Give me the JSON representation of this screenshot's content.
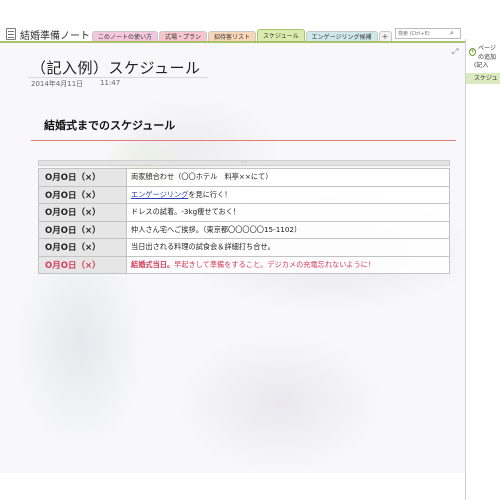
{
  "notebook": {
    "title": "結婚準備ノート",
    "tabs": [
      {
        "label": "このノートの使い方",
        "color": "#f3c8dc",
        "active": false
      },
      {
        "label": "式場・プラン",
        "color": "#f6c6cc",
        "active": false
      },
      {
        "label": "招待客リスト",
        "color": "#f8d7b9",
        "active": false
      },
      {
        "label": "スケジュール",
        "color": "#d9ecae",
        "active": true
      },
      {
        "label": "エンゲージリング候補",
        "color": "#cfe8ea",
        "active": false
      }
    ],
    "add_tab_label": "+",
    "search_placeholder": "検索 (Ctrl+E)"
  },
  "right_pane": {
    "add_page_label": "ページの追加",
    "pages": [
      "(記入",
      "スケジュ"
    ]
  },
  "page": {
    "title": "（記入例）スケジュール",
    "date": "2014年4月11日",
    "time": "11:47",
    "heading": "結婚式までのスケジュール"
  },
  "schedule": {
    "rows": [
      {
        "date": "O月O日（×）",
        "desc": "両家顔合わせ（〇〇ホテル　料亭××にて）"
      },
      {
        "date": "O月O日（×）",
        "link": "エンゲージリング",
        "desc": "を見に行く！"
      },
      {
        "date": "O月O日（×）",
        "desc": "ドレスの試着。-3kg痩せておく！"
      },
      {
        "date": "O月O日（×）",
        "desc": "仲人さん宅へご挨拶。（東京都〇〇〇〇〇15-1102）"
      },
      {
        "date": "O月O日（×）",
        "desc": "当日出される料理の試食会＆詳細打ち合せ。"
      },
      {
        "date": "O月O日（×）",
        "emph": "結婚式当日。",
        "desc": "早起きして準備をすること。デジカメの充電忘れないように！"
      }
    ]
  },
  "colors": {
    "accent_green": "#a9c26b",
    "heading_rule": "#e07a7a",
    "wedding_text": "#d23a5a",
    "link": "#2b3fb0"
  }
}
